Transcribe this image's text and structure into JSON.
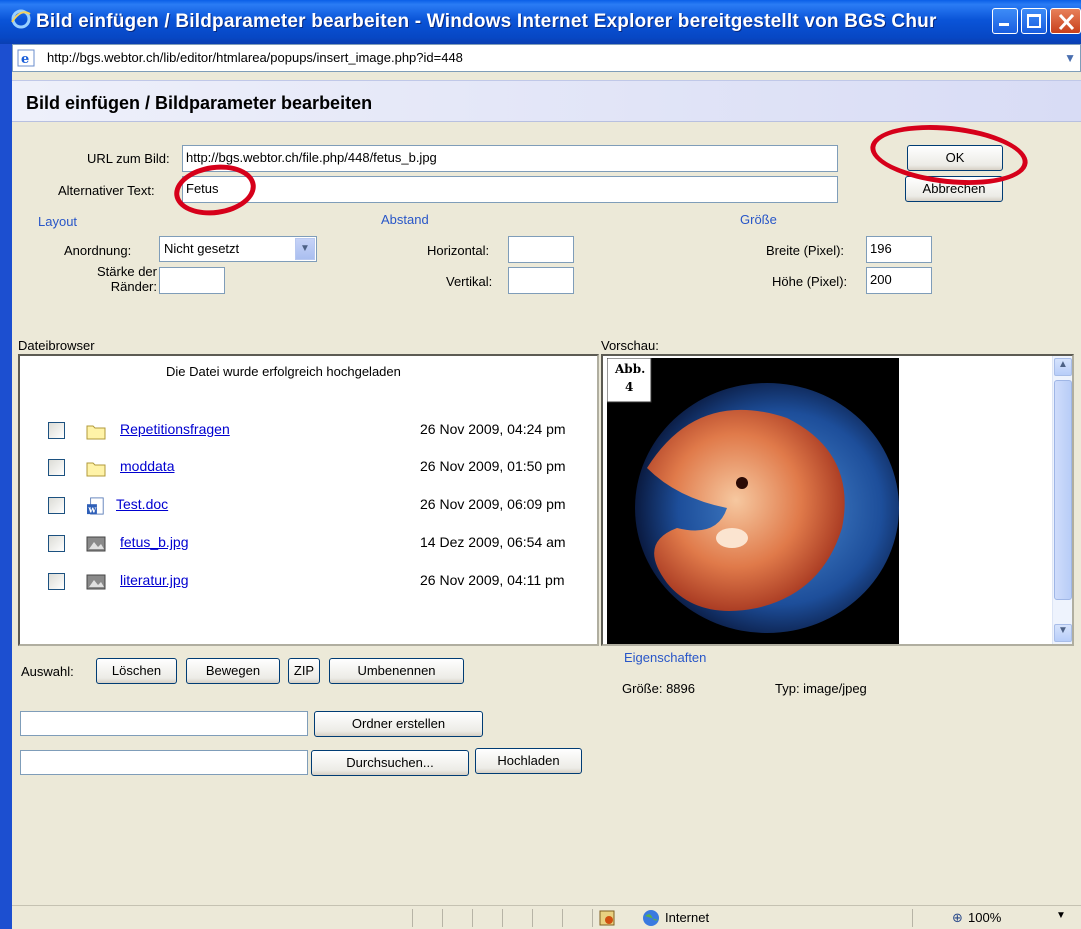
{
  "window": {
    "title": "Bild einfügen / Bildparameter bearbeiten - Windows Internet Explorer bereitgestellt von BGS Chur",
    "url": "http://bgs.webtor.ch/lib/editor/htmlarea/popups/insert_image.php?id=448"
  },
  "dialog": {
    "heading": "Bild einfügen / Bildparameter bearbeiten",
    "url_label": "URL zum Bild:",
    "url_value": "http://bgs.webtor.ch/file.php/448/fetus_b.jpg",
    "alt_label": "Alternativer Text:",
    "alt_value": "Fetus",
    "ok_label": "OK",
    "cancel_label": "Abbrechen"
  },
  "layout": {
    "section": "Layout",
    "align_label": "Anordnung:",
    "align_value": "Nicht gesetzt",
    "border_label_1": "Stärke der",
    "border_label_2": "Ränder:",
    "border_value": ""
  },
  "spacing": {
    "section": "Abstand",
    "horizontal_label": "Horizontal:",
    "horizontal_value": "",
    "vertical_label": "Vertikal:",
    "vertical_value": ""
  },
  "size": {
    "section": "Größe",
    "width_label": "Breite (Pixel):",
    "width_value": "196",
    "height_label": "Höhe (Pixel):",
    "height_value": "200"
  },
  "filebrowser": {
    "label": "Dateibrowser",
    "message": "Die Datei wurde erfolgreich hochgeladen",
    "files": [
      {
        "name": "Repetitionsfragen",
        "date": "26 Nov 2009, 04:24 pm",
        "icon": "folder-icon"
      },
      {
        "name": "moddata",
        "date": "26 Nov 2009, 01:50 pm",
        "icon": "folder-icon"
      },
      {
        "name": "Test.doc",
        "date": "26 Nov 2009, 06:09 pm",
        "icon": "word-doc-icon"
      },
      {
        "name": "fetus_b.jpg",
        "date": "14 Dez 2009, 06:54 am",
        "icon": "image-file-icon"
      },
      {
        "name": "literatur.jpg",
        "date": "26 Nov 2009, 04:11 pm",
        "icon": "image-file-icon"
      }
    ]
  },
  "preview": {
    "label": "Vorschau:",
    "caption_line1": "Abb.",
    "caption_line2": "4",
    "properties_label": "Eigenschaften",
    "size_text": "Größe: 8896",
    "type_text": "Typ: image/jpeg"
  },
  "actions": {
    "selection_label": "Auswahl:",
    "delete": "Löschen",
    "move": "Bewegen",
    "zip": "ZIP",
    "rename": "Umbenennen",
    "folder_value": "",
    "create_folder": "Ordner erstellen",
    "upload_path": "",
    "browse": "Durchsuchen...",
    "upload": "Hochladen"
  },
  "statusbar": {
    "zone": "Internet",
    "zoom": "100%"
  },
  "colors": {
    "titlebar": "#0a54d8",
    "link": "#0000d0",
    "section": "#2856c8",
    "annotation_red": "#d6001a"
  }
}
